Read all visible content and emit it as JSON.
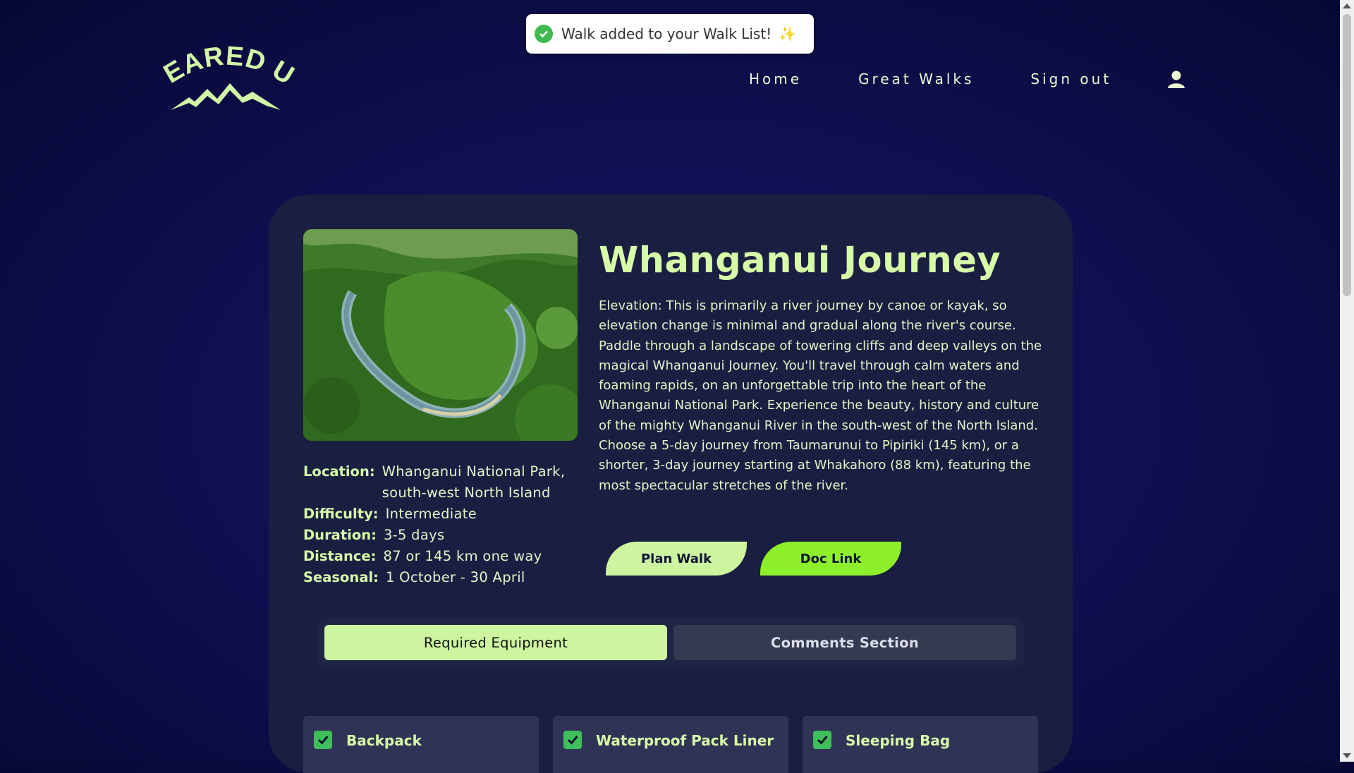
{
  "toast": {
    "message": "Walk added to your Walk List!",
    "emoji": "✨"
  },
  "brand": {
    "logo_text": "GEARED UP"
  },
  "nav": {
    "items": [
      "Home",
      "Great Walks",
      "Sign out"
    ]
  },
  "walk": {
    "title": "Whanganui Journey",
    "description": "Elevation: This is primarily a river journey by canoe or kayak, so elevation change is minimal and gradual along the river's course. Paddle through a landscape of towering cliffs and deep valleys on the magical Whanganui Journey. You'll travel through calm waters and foaming rapids, on an unforgettable trip into the heart of the Whanganui National Park. Experience the beauty, history and culture of the mighty Whanganui River in the south-west of the North Island. Choose a 5-day journey from Taumarunui to Pipiriki (145 km), or a shorter, 3-day journey starting at Whakahoro (88 km), featuring the most spectacular stretches of the river.",
    "facts": [
      {
        "label": "Location:",
        "value": "Whanganui National Park, south-west North Island"
      },
      {
        "label": "Difficulty:",
        "value": "Intermediate"
      },
      {
        "label": "Duration:",
        "value": "3-5 days"
      },
      {
        "label": "Distance:",
        "value": "87 or 145 km one way"
      },
      {
        "label": "Seasonal:",
        "value": "1 October - 30 April"
      }
    ]
  },
  "buttons": {
    "plan": "Plan Walk",
    "doc": "Doc Link"
  },
  "tabs": [
    {
      "label": "Required Equipment",
      "active": true
    },
    {
      "label": "Comments Section",
      "active": false
    }
  ],
  "equipment": [
    {
      "name": "Backpack",
      "checked": true
    },
    {
      "name": "Waterproof Pack Liner",
      "checked": true
    },
    {
      "name": "Sleeping Bag",
      "checked": true
    }
  ],
  "colors": {
    "accent": "#d8fba8",
    "doc_button": "#8ef02a",
    "background": "#0c0c45",
    "card": "#1a1f42"
  }
}
